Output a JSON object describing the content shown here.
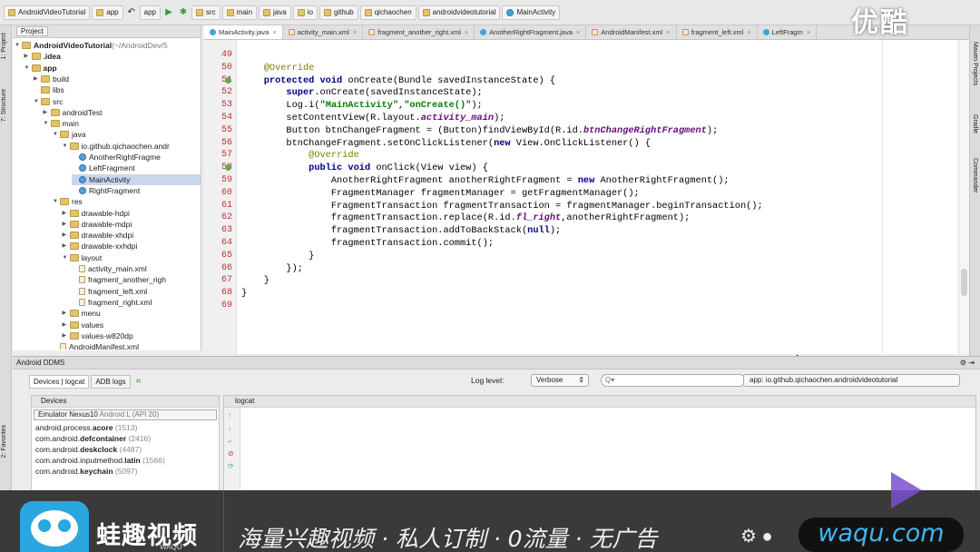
{
  "breadcrumbs": [
    "AndroidVideoTutorial",
    "app",
    "src",
    "main",
    "java",
    "io",
    "github",
    "qichaochen",
    "androidvideotutorial",
    "MainActivity"
  ],
  "toolbar": {
    "run_config": "app"
  },
  "left_strip": [
    "1: Project",
    "7: Structure",
    "2: Favorites"
  ],
  "right_strip": [
    "Maven Projects",
    "Gradle",
    "Commander"
  ],
  "project_panel": {
    "header": "Project"
  },
  "tree": [
    {
      "label": "AndroidVideoTutorial",
      "suffix": " (~/AndroidDev/5",
      "type": "folder",
      "depth": 0,
      "open": true
    },
    {
      "label": ".idea",
      "type": "folder",
      "depth": 1,
      "open": false
    },
    {
      "label": "app",
      "type": "folder",
      "depth": 1,
      "open": true
    },
    {
      "label": "build",
      "type": "folder",
      "depth": 2,
      "open": false
    },
    {
      "label": "libs",
      "type": "folder",
      "depth": 2,
      "open": null
    },
    {
      "label": "src",
      "type": "folder",
      "depth": 2,
      "open": true
    },
    {
      "label": "androidTest",
      "type": "folder",
      "depth": 3,
      "open": false
    },
    {
      "label": "main",
      "type": "folder",
      "depth": 3,
      "open": true
    },
    {
      "label": "java",
      "type": "folder",
      "depth": 4,
      "open": true
    },
    {
      "label": "io.github.qichaochen.andr",
      "type": "folder",
      "depth": 5,
      "open": true
    },
    {
      "label": "AnotherRightFragme",
      "type": "cls",
      "depth": 6,
      "open": null
    },
    {
      "label": "LeftFragment",
      "type": "cls",
      "depth": 6,
      "open": null
    },
    {
      "label": "MainActivity",
      "type": "cls",
      "depth": 6,
      "open": null,
      "selected": true
    },
    {
      "label": "RightFragment",
      "type": "cls",
      "depth": 6,
      "open": null
    },
    {
      "label": "res",
      "type": "folder",
      "depth": 4,
      "open": true
    },
    {
      "label": "drawable-hdpi",
      "type": "folder",
      "depth": 5,
      "open": false
    },
    {
      "label": "drawable-mdpi",
      "type": "folder",
      "depth": 5,
      "open": false
    },
    {
      "label": "drawable-xhdpi",
      "type": "folder",
      "depth": 5,
      "open": false
    },
    {
      "label": "drawable-xxhdpi",
      "type": "folder",
      "depth": 5,
      "open": false
    },
    {
      "label": "layout",
      "type": "folder",
      "depth": 5,
      "open": true
    },
    {
      "label": "activity_main.xml",
      "type": "xml",
      "depth": 6,
      "open": null
    },
    {
      "label": "fragment_another_righ",
      "type": "xml",
      "depth": 6,
      "open": null
    },
    {
      "label": "fragment_left.xml",
      "type": "xml",
      "depth": 6,
      "open": null
    },
    {
      "label": "fragment_right.xml",
      "type": "xml",
      "depth": 6,
      "open": null
    },
    {
      "label": "menu",
      "type": "folder",
      "depth": 5,
      "open": false
    },
    {
      "label": "values",
      "type": "folder",
      "depth": 5,
      "open": false
    },
    {
      "label": "values-w820dp",
      "type": "folder",
      "depth": 5,
      "open": false
    },
    {
      "label": "AndroidManifest.xml",
      "type": "xml",
      "depth": 4,
      "open": null
    }
  ],
  "editor_tabs": [
    {
      "label": "MainActivity.java",
      "kind": "java",
      "active": true
    },
    {
      "label": "activity_main.xml",
      "kind": "xml"
    },
    {
      "label": "fragment_another_right.xml",
      "kind": "xml"
    },
    {
      "label": "AnotherRightFragment.java",
      "kind": "java"
    },
    {
      "label": "AndroidManifest.xml",
      "kind": "xml"
    },
    {
      "label": "fragment_left.xml",
      "kind": "xml"
    },
    {
      "label": "LeftFragm",
      "kind": "java"
    }
  ],
  "code_first_line": 49,
  "code": [
    [],
    [
      [
        "an",
        "    @Override"
      ]
    ],
    [
      [
        "kw",
        "    protected void "
      ],
      [
        "",
        "onCreate(Bundle savedInstanceState) {"
      ]
    ],
    [
      [
        "kw",
        "        super"
      ],
      [
        "",
        ".onCreate(savedInstanceState);"
      ]
    ],
    [
      [
        "",
        "        Log."
      ],
      [
        "",
        "i("
      ],
      [
        "str",
        "\"MainActivity\""
      ],
      [
        "",
        ","
      ],
      [
        "str",
        "\"onCreate()\""
      ],
      [
        "",
        ");"
      ]
    ],
    [
      [
        "",
        "        setContentView(R.layout."
      ],
      [
        "fld",
        "activity_main"
      ],
      [
        "",
        ");"
      ]
    ],
    [
      [
        "",
        "        Button btnChangeFragment = (Button)findViewById(R.id."
      ],
      [
        "fld",
        "btnChangeRightFragment"
      ],
      [
        "",
        ");"
      ]
    ],
    [
      [
        "",
        "        btnChangeFragment.setOnClickListener("
      ],
      [
        "kw",
        "new "
      ],
      [
        "",
        "View.OnClickListener() {"
      ]
    ],
    [
      [
        "an",
        "            @Override"
      ]
    ],
    [
      [
        "kw",
        "            public void "
      ],
      [
        "",
        "onClick(View view) {"
      ]
    ],
    [
      [
        "",
        "                AnotherRightFragment anotherRightFragment = "
      ],
      [
        "kw",
        "new "
      ],
      [
        "",
        "AnotherRightFragment();"
      ]
    ],
    [
      [
        "",
        "                FragmentManager fragmentManager = getFragmentManager();"
      ]
    ],
    [
      [
        "",
        "                FragmentTransaction fragmentTransaction = fragmentManager.beginTransaction();"
      ]
    ],
    [
      [
        "",
        "                fragmentTransaction.replace(R.id."
      ],
      [
        "fld",
        "fl_right"
      ],
      [
        "",
        ",anotherRightFragment);"
      ]
    ],
    [
      [
        "",
        "                fragmentTransaction.addToBackStack("
      ],
      [
        "kw",
        "null"
      ],
      [
        "",
        ");"
      ]
    ],
    [
      [
        "",
        "                fragmentTransaction.commit();"
      ]
    ],
    [
      [
        "",
        "            }"
      ]
    ],
    [
      [
        "",
        "        });"
      ]
    ],
    [
      [
        "",
        "    }"
      ]
    ],
    [
      [
        "",
        "}"
      ]
    ],
    []
  ],
  "ddms": {
    "title": "Android DDMS",
    "tabs": [
      "Devices | logcat",
      "ADB logs"
    ],
    "log_level_label": "Log level:",
    "log_level_value": "Verbose",
    "search_placeholder": "Q▾",
    "app_filter": "app: io.github.qichaochen.androidvideotutorial",
    "devices_header": "Devices",
    "emulator": "Emulator Nexus10",
    "emulator_api": " Android L (API 20)",
    "processes": [
      {
        "pre": "android.process.",
        "bold": "acore",
        "pid": " (1513)"
      },
      {
        "pre": "com.android.",
        "bold": "defcontainer",
        "pid": " (2416)"
      },
      {
        "pre": "com.android.",
        "bold": "deskclock",
        "pid": " (4487)"
      },
      {
        "pre": "com.android.inputmethod.",
        "bold": "latin",
        "pid": " (1566)"
      },
      {
        "pre": "com.android.",
        "bold": "keychain",
        "pid": " (5097)"
      }
    ],
    "logcat_header": "logcat"
  },
  "banner": {
    "brand": "蛙趣视频",
    "brand_sub": "WAQU",
    "slogan": "海量兴趣视频 · 私人订制 · 0流量 · 无广告",
    "site": "waqu.com",
    "watermark": "优酷",
    "brand_color": "#2aa6e0"
  }
}
